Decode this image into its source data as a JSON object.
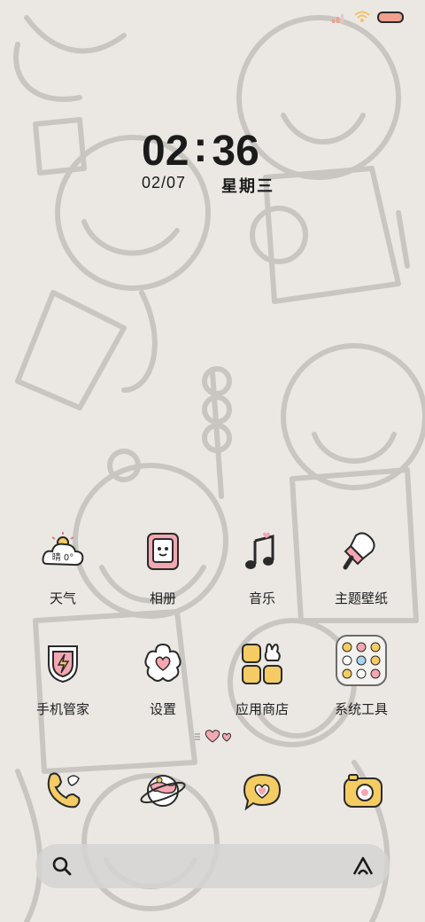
{
  "status_bar": {
    "signal_icon": "signal-icon",
    "wifi_icon": "wifi-icon",
    "battery_icon": "battery-icon",
    "battery_color": "#f0a08e"
  },
  "clock": {
    "hours": "02",
    "separator": ":",
    "minutes": "36",
    "date": "02/07",
    "weekday": "星期三"
  },
  "weather_icon_text": "晴 0°",
  "apps": [
    {
      "label": "天气",
      "icon": "weather-cloud-icon"
    },
    {
      "label": "相册",
      "icon": "photo-album-icon"
    },
    {
      "label": "音乐",
      "icon": "music-note-icon"
    },
    {
      "label": "主题壁纸",
      "icon": "paintbrush-icon"
    },
    {
      "label": "手机管家",
      "icon": "shield-bolt-icon"
    },
    {
      "label": "设置",
      "icon": "flower-heart-icon"
    },
    {
      "label": "应用商店",
      "icon": "app-store-icon"
    },
    {
      "label": "系统工具",
      "icon": "folder-icon"
    }
  ],
  "page_indicator": {
    "icon": "hearts-page-indicator-icon"
  },
  "dock": [
    {
      "icon": "phone-icon"
    },
    {
      "icon": "browser-planet-icon"
    },
    {
      "icon": "message-heart-icon"
    },
    {
      "icon": "camera-icon"
    }
  ],
  "search_bar": {
    "search_icon": "search-icon",
    "assistant_icon": "assistant-icon"
  },
  "colors": {
    "background": "#ebe8e4",
    "pink": "#f4a7b2",
    "yellow": "#f5cc63",
    "outline": "#2a2a2a"
  }
}
